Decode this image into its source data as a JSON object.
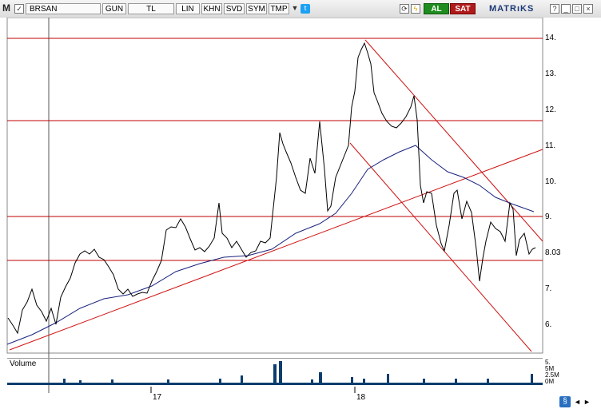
{
  "toolbar": {
    "logo": "M",
    "symbol": "BRSAN",
    "period": "GUN",
    "currency": "TL",
    "scale": "LIN",
    "buttons": [
      "KHN",
      "SVD",
      "SYM",
      "TMP"
    ],
    "buy": "AL",
    "sell": "SAT",
    "brand": "MATRıKS",
    "colors": {
      "buy": "#1e8c1e",
      "sell": "#b01a1a",
      "brand": "#1d3a78"
    }
  },
  "chart": {
    "price_labels": [
      "14.",
      "13.",
      "12.",
      "11.",
      "10.",
      "9.",
      "8.03",
      "7.",
      "6."
    ],
    "volume_label": "Volume",
    "volume_axis": [
      "5.",
      "5M",
      "2.5M",
      "0M"
    ],
    "x_labels": [
      "17",
      "18"
    ],
    "colors": {
      "price": "#000000",
      "ma": "#1a237e",
      "levels": "#c00000",
      "volume": "#0b3d6e"
    }
  }
}
